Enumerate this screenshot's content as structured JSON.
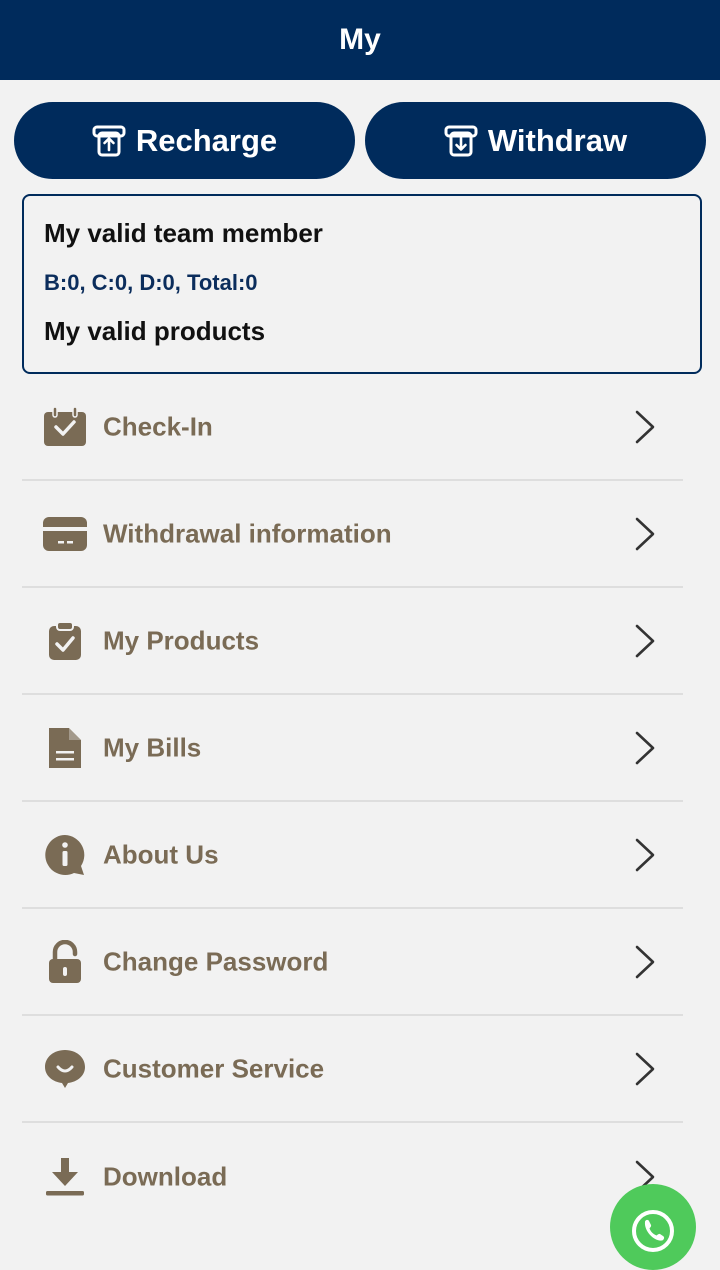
{
  "header": {
    "title": "My"
  },
  "actions": {
    "recharge_label": "Recharge",
    "withdraw_label": "Withdraw"
  },
  "team_card": {
    "team_label": "My valid team member",
    "team_stats": "B:0, C:0, D:0, Total:0",
    "products_label": "My valid products"
  },
  "menu": {
    "items": [
      {
        "label": "Check-In",
        "icon": "calendar-check-icon"
      },
      {
        "label": "Withdrawal information",
        "icon": "card-icon"
      },
      {
        "label": "My Products",
        "icon": "clipboard-check-icon"
      },
      {
        "label": "My Bills",
        "icon": "document-icon"
      },
      {
        "label": "About Us",
        "icon": "info-bubble-icon"
      },
      {
        "label": "Change Password",
        "icon": "lock-icon"
      },
      {
        "label": "Customer Service",
        "icon": "chat-bubble-icon"
      },
      {
        "label": "Download",
        "icon": "download-icon"
      }
    ]
  },
  "colors": {
    "primary": "#002b5c",
    "menu_text": "#7a6b55",
    "background": "#f2f2f2",
    "whatsapp": "#4fca5b"
  }
}
